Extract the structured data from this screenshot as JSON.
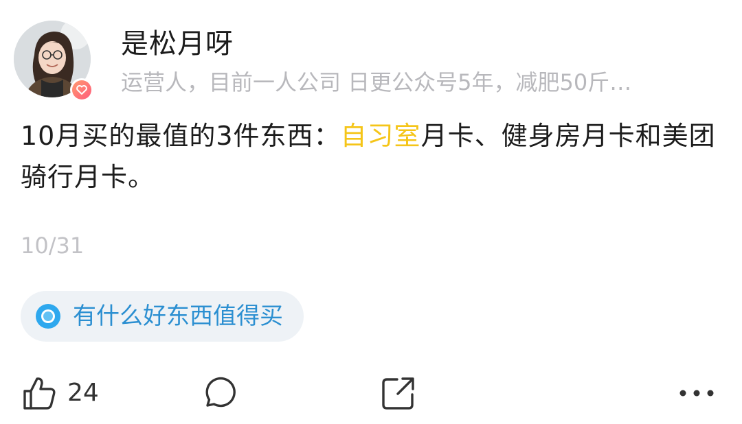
{
  "author": {
    "name": "是松月呀",
    "bio": "运营人，目前一人公司  日更公众号5年，减肥50斤…",
    "avatar_badge_icon": "heart-badge-icon"
  },
  "post": {
    "text_before": "10月买的最值的3件东西：",
    "highlight": "自习室",
    "text_after": "月卡、健身房月卡和美团骑行月卡。",
    "highlight_color": "#f5c518",
    "date": "10/31"
  },
  "topic": {
    "label": "有什么好东西值得买",
    "icon": "topic-circle-icon",
    "color": "#2b8fd1"
  },
  "actions": {
    "like_count": "24",
    "like_icon": "thumbs-up-icon",
    "comment_icon": "comment-bubble-icon",
    "share_icon": "share-arrow-icon",
    "more_icon": "more-dots-icon"
  }
}
